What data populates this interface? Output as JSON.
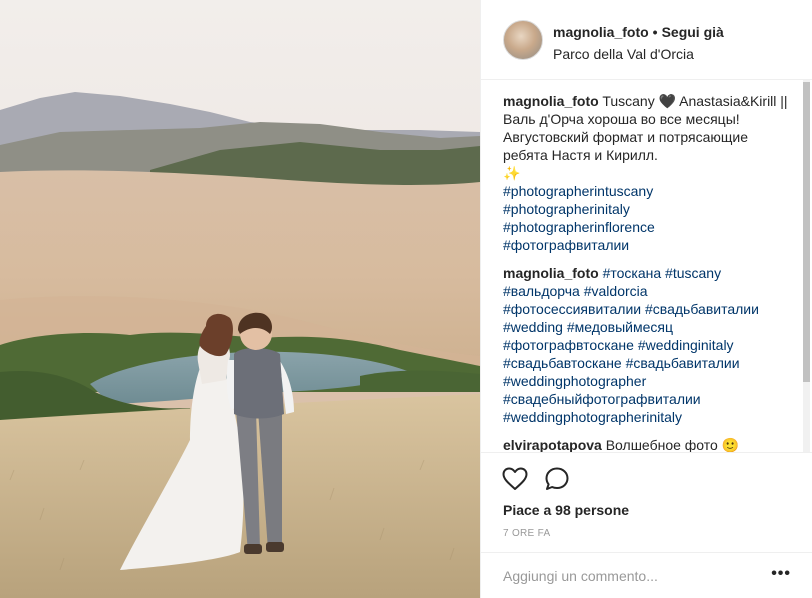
{
  "post": {
    "username": "magnolia_foto",
    "separator": "•",
    "follow_status": "Segui già",
    "location": "Parco della Val d'Orcia"
  },
  "caption": {
    "username": "magnolia_foto",
    "text_line1": "Tuscany 🖤 Anastasia&Kirill ||",
    "text_line2": "Валь д'Орча хороша во все месяцы!",
    "text_line3": "Августовский формат и потрясающие",
    "text_line4": "ребята Настя и Кирилл.",
    "sparkle": "✨",
    "hashtags": [
      "#photographerintuscany",
      "#photographerinitaly",
      "#photographerinflorence",
      "#фотографвиталии"
    ]
  },
  "comment2": {
    "username": "magnolia_foto",
    "lines": [
      [
        "#тоскана",
        "#tuscany"
      ],
      [
        "#вальдорча",
        "#valdorcia"
      ],
      [
        "#фотосессиявиталии",
        "#свадьбавиталии"
      ],
      [
        "#wedding",
        "#медовыймесяц"
      ],
      [
        "#фотографвтоскане",
        "#weddinginitaly"
      ],
      [
        "#свадьбавтоскане",
        "#свадьбавиталии"
      ],
      [
        "#weddingphotographer"
      ],
      [
        "#свадебныйфотографвиталии"
      ],
      [
        "#weddingphotographerinitaly"
      ]
    ]
  },
  "comment3": {
    "username": "elvirapotapova",
    "text": "Волшебное фото 🙂"
  },
  "actions": {
    "like_icon": "heart-outline-icon",
    "comment_icon": "speech-bubble-icon",
    "likes_text": "Piace a 98 persone",
    "timestamp": "7 ORE FA"
  },
  "add_comment": {
    "placeholder": "Aggiungi un commento...",
    "more_label": "•••"
  }
}
